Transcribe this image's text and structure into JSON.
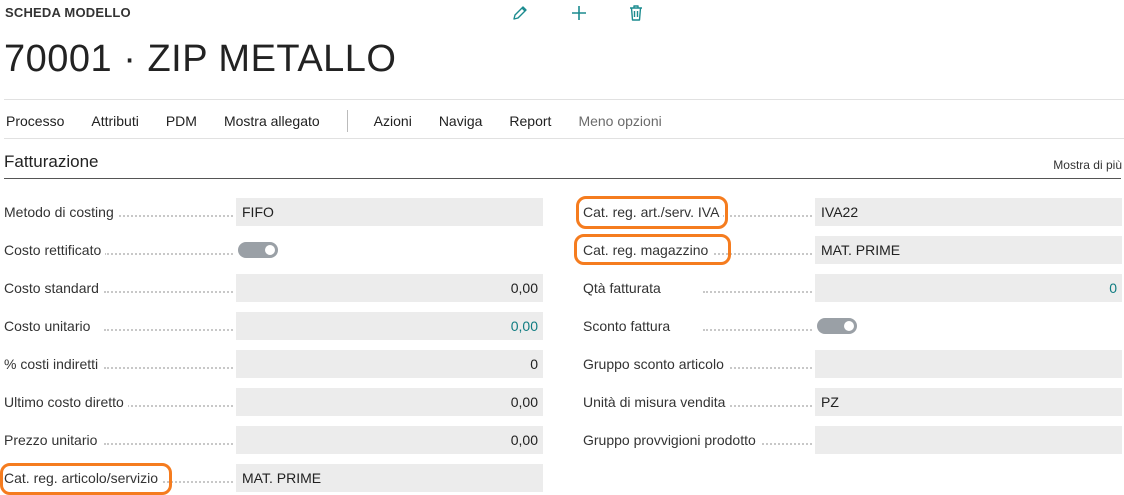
{
  "header": {
    "label": "SCHEDA MODELLO",
    "icons": [
      "pencil-icon",
      "plus-icon",
      "trash-icon"
    ],
    "title": "70001 · ZIP METALLO"
  },
  "menu": {
    "items": [
      "Processo",
      "Attributi",
      "PDM",
      "Mostra allegato"
    ],
    "items_after_separator": [
      "Azioni",
      "Naviga",
      "Report",
      "Meno opzioni"
    ]
  },
  "section": {
    "title": "Fatturazione",
    "show_more": "Mostra di più"
  },
  "left_fields": [
    {
      "label": "Metodo di costing",
      "value": "FIFO"
    },
    {
      "label": "Costo rettificato",
      "toggle": true
    },
    {
      "label": "Costo standard",
      "value": "0,00"
    },
    {
      "label": "Costo unitario",
      "value": "0,00"
    },
    {
      "label": "% costi indiretti",
      "value": "0"
    },
    {
      "label": "Ultimo costo diretto",
      "value": "0,00"
    },
    {
      "label": "Prezzo unitario",
      "value": "0,00"
    },
    {
      "label": "Cat. reg. articolo/servizio",
      "value": "MAT. PRIME"
    }
  ],
  "right_fields": [
    {
      "label": "Cat. reg. art./serv. IVA",
      "value": "IVA22"
    },
    {
      "label": "Cat. reg. magazzino",
      "value": "MAT. PRIME"
    },
    {
      "label": "Qtà fatturata",
      "value": "0"
    },
    {
      "label": "Sconto fattura",
      "toggle": true
    },
    {
      "label": "Gruppo sconto articolo",
      "value": ""
    },
    {
      "label": "Unità di misura vendita",
      "value": "PZ"
    },
    {
      "label": "Gruppo provvigioni prodotto",
      "value": ""
    }
  ],
  "colors": {
    "highlight": "#f57c1f",
    "link_teal": "#0f7c81",
    "field_bg": "#ececec",
    "toggle_bg": "#9aa0a6",
    "icon_teal": "#1b8b8f"
  }
}
